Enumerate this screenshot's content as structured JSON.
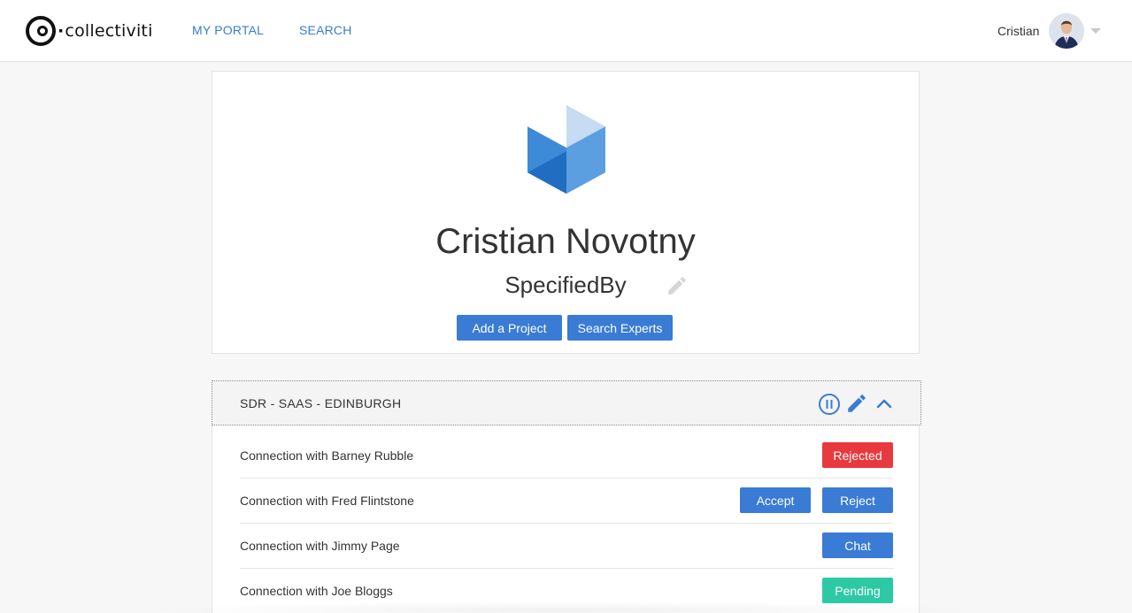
{
  "header": {
    "logo_text": "collectiviti",
    "nav": [
      {
        "label": "MY PORTAL"
      },
      {
        "label": "SEARCH"
      }
    ],
    "user_name": "Cristian"
  },
  "profile": {
    "name": "Cristian Novotny",
    "company": "SpecifiedBy",
    "add_project_label": "Add a Project",
    "search_experts_label": "Search Experts"
  },
  "project": {
    "title": "SDR - SAAS - EDINBURGH",
    "connections": [
      {
        "label": "Connection with Barney Rubble",
        "status": "Rejected"
      },
      {
        "label": "Connection with Fred Flintstone",
        "accept_label": "Accept",
        "reject_label": "Reject"
      },
      {
        "label": "Connection with Jimmy Page",
        "chat_label": "Chat"
      },
      {
        "label": "Connection with Joe Bloggs",
        "status": "Pending"
      }
    ]
  },
  "colors": {
    "accent": "#3a7bd5",
    "rejected": "#e8393f",
    "pending": "#2cc9a4"
  }
}
